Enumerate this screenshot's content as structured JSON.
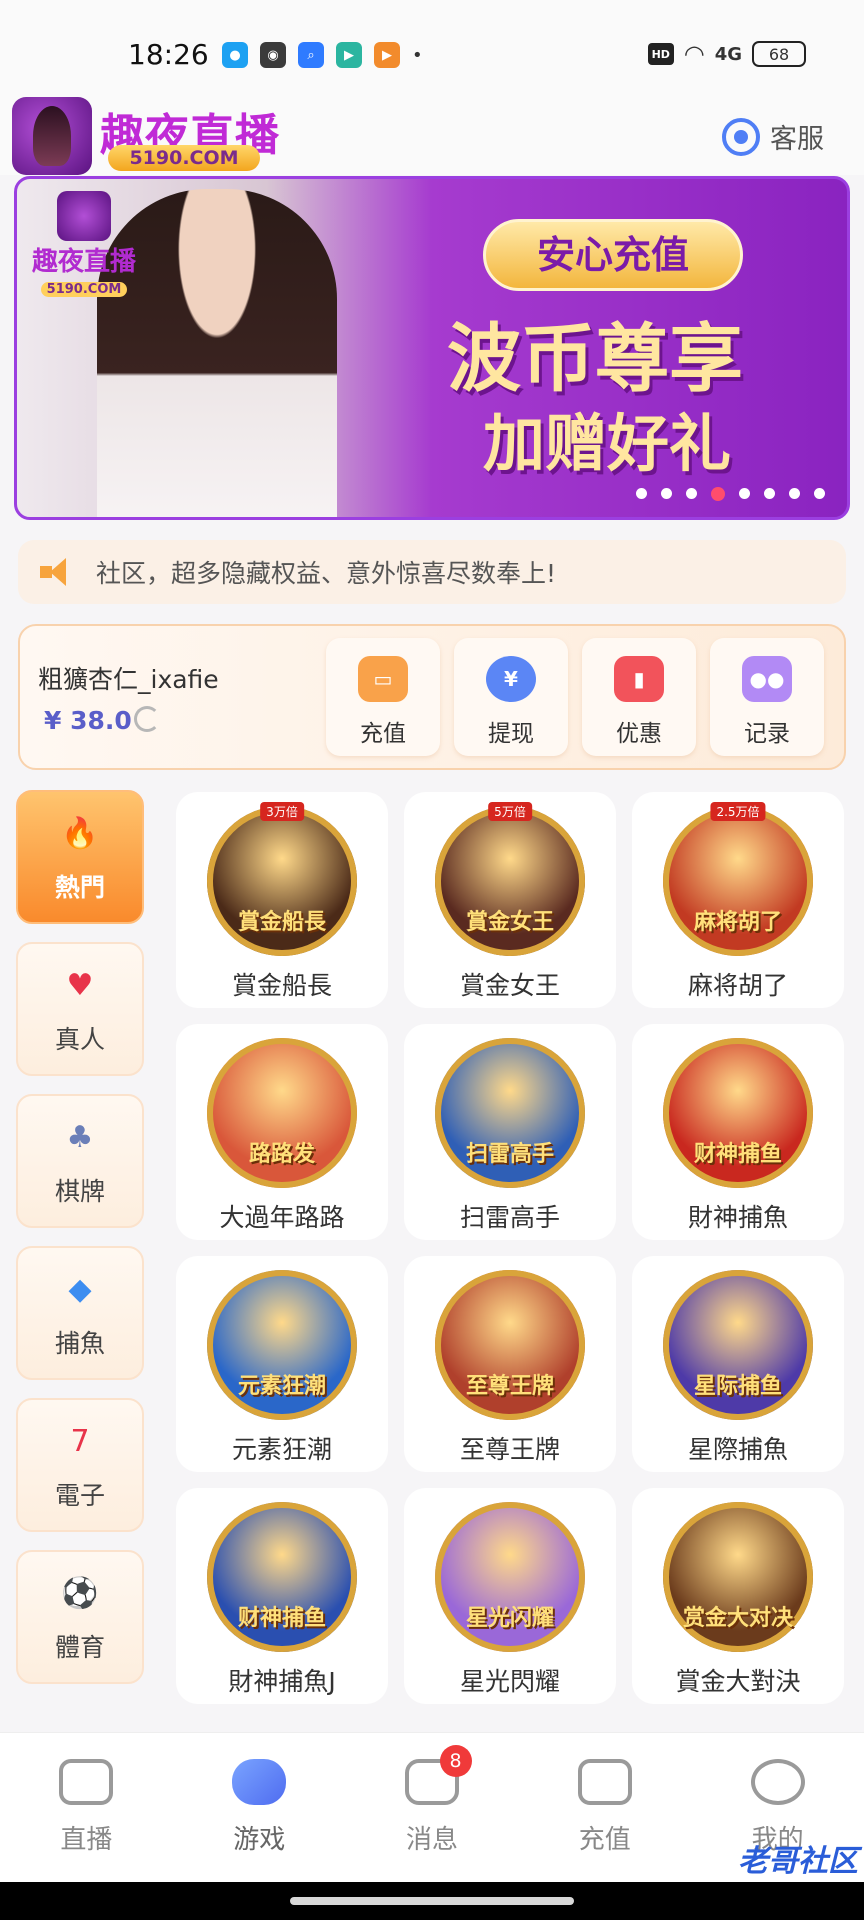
{
  "status_bar": {
    "time": "18:26",
    "signal": "4G",
    "battery": "68"
  },
  "header": {
    "app_name": "趣夜直播",
    "domain": "5190.COM",
    "service_label": "客服"
  },
  "banner": {
    "logo_name": "趣夜直播",
    "logo_domain": "5190.COM",
    "tag": "安心充值",
    "title": "波币尊享",
    "subtitle": "加赠好礼",
    "dots_total": 8,
    "active_dot": 4
  },
  "notice": {
    "text": "社区，超多隐藏权益、意外惊喜尽数奉上!"
  },
  "wallet": {
    "username": "粗獷杏仁_ixafie",
    "balance": "¥ 38.0",
    "actions": [
      {
        "label": "充值",
        "icon": "wallet-icon",
        "color": "#f9a24a"
      },
      {
        "label": "提现",
        "icon": "yen-icon",
        "color": "#5b86f5"
      },
      {
        "label": "优惠",
        "icon": "ticket-icon",
        "color": "#f2535b"
      },
      {
        "label": "记录",
        "icon": "gamepad-icon",
        "color": "#b28af5"
      }
    ]
  },
  "categories": [
    {
      "label": "熱門",
      "icon": "flame-icon",
      "active": true
    },
    {
      "label": "真人",
      "icon": "poker-chip-icon",
      "active": false
    },
    {
      "label": "棋牌",
      "icon": "playing-cards-icon",
      "active": false
    },
    {
      "label": "捕魚",
      "icon": "shark-icon",
      "active": false
    },
    {
      "label": "電子",
      "icon": "slot-777-icon",
      "active": false
    },
    {
      "label": "體育",
      "icon": "soccer-ball-icon",
      "active": false
    }
  ],
  "games": [
    {
      "name": "賞金船長",
      "art_text": "賞金船長",
      "multiplier": "3万倍",
      "bg": "#4b2a18"
    },
    {
      "name": "賞金女王",
      "art_text": "賞金女王",
      "multiplier": "5万倍",
      "bg": "#5a2a20"
    },
    {
      "name": "麻将胡了",
      "art_text": "麻将胡了",
      "multiplier": "2.5万倍",
      "bg": "#c23a22"
    },
    {
      "name": "大過年路路",
      "art_text": "路路发",
      "multiplier": "",
      "bg": "#d9573a"
    },
    {
      "name": "扫雷高手",
      "art_text": "扫雷高手",
      "multiplier": "",
      "bg": "#2f5fb6"
    },
    {
      "name": "財神捕魚",
      "art_text": "财神捕鱼",
      "multiplier": "",
      "bg": "#c9281f"
    },
    {
      "name": "元素狂潮",
      "art_text": "元素狂潮",
      "multiplier": "",
      "bg": "#2a67c9"
    },
    {
      "name": "至尊王牌",
      "art_text": "至尊王牌",
      "multiplier": "",
      "bg": "#b0402c"
    },
    {
      "name": "星際捕魚",
      "art_text": "星际捕鱼",
      "multiplier": "",
      "bg": "#4e3aa8"
    },
    {
      "name": "財神捕魚J",
      "art_text": "财神捕鱼",
      "multiplier": "",
      "bg": "#2a4fb0"
    },
    {
      "name": "星光閃耀",
      "art_text": "星光闪耀",
      "multiplier": "",
      "bg": "#9a68d8"
    },
    {
      "name": "賞金大對決",
      "art_text": "赏金大对决",
      "multiplier": "",
      "bg": "#6b3b1c"
    }
  ],
  "bottom_nav": [
    {
      "label": "直播",
      "icon": "tv-icon",
      "active": false,
      "badge": ""
    },
    {
      "label": "游戏",
      "icon": "gamepad-icon",
      "active": true,
      "badge": ""
    },
    {
      "label": "消息",
      "icon": "chat-icon",
      "active": false,
      "badge": "8"
    },
    {
      "label": "充值",
      "icon": "card-icon",
      "active": false,
      "badge": ""
    },
    {
      "label": "我的",
      "icon": "face-icon",
      "active": false,
      "badge": ""
    }
  ],
  "watermark": "老哥社区"
}
